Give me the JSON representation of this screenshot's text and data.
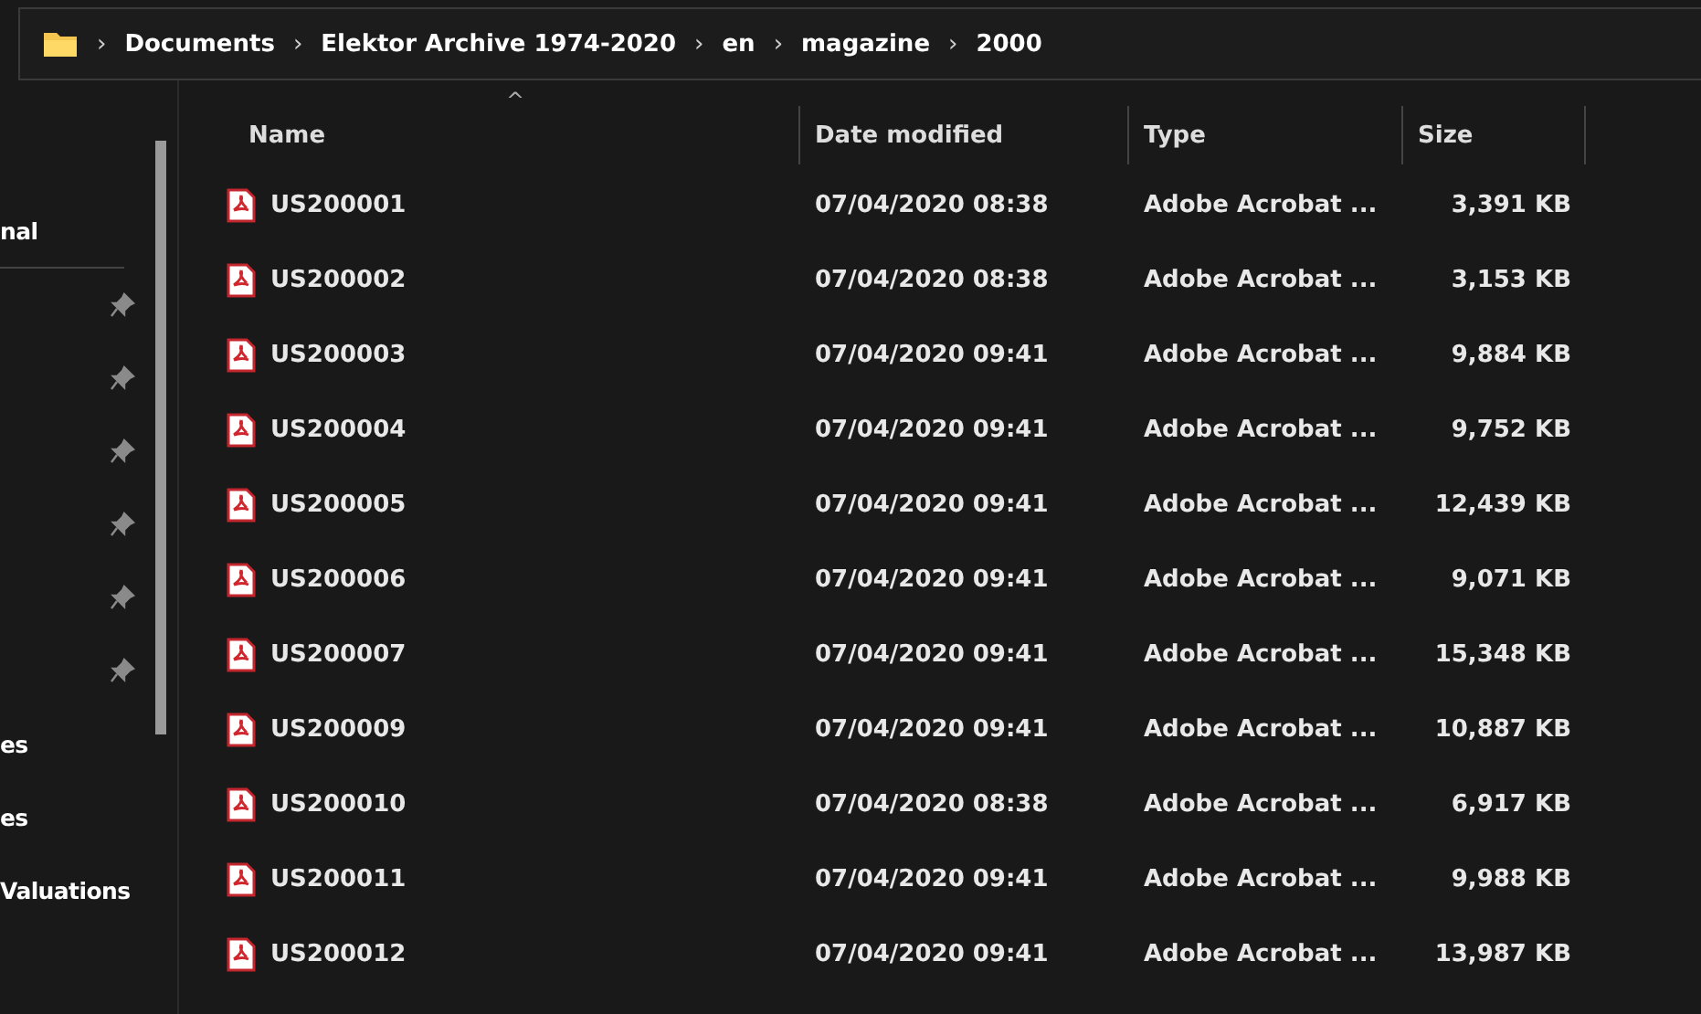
{
  "breadcrumb": {
    "segments": [
      "Documents",
      "Elektor Archive 1974-2020",
      "en",
      "magazine",
      "2000"
    ],
    "separator": "›"
  },
  "sidebar": {
    "items": [
      {
        "label": "nal",
        "pinned": false
      },
      {
        "pinned": true
      },
      {
        "pinned": true
      },
      {
        "pinned": true
      },
      {
        "pinned": true
      },
      {
        "pinned": true
      },
      {
        "pinned": true
      },
      {
        "label": "es",
        "pinned": false
      },
      {
        "label": "es",
        "pinned": false
      },
      {
        "label": "Valuations",
        "pinned": false
      }
    ]
  },
  "table": {
    "sort_indicator": "^",
    "columns": [
      "Name",
      "Date modified",
      "Type",
      "Size"
    ],
    "rows": [
      {
        "name": "US200001",
        "date": "07/04/2020 08:38",
        "type": "Adobe Acrobat ...",
        "size": "3,391 KB"
      },
      {
        "name": "US200002",
        "date": "07/04/2020 08:38",
        "type": "Adobe Acrobat ...",
        "size": "3,153 KB"
      },
      {
        "name": "US200003",
        "date": "07/04/2020 09:41",
        "type": "Adobe Acrobat ...",
        "size": "9,884 KB"
      },
      {
        "name": "US200004",
        "date": "07/04/2020 09:41",
        "type": "Adobe Acrobat ...",
        "size": "9,752 KB"
      },
      {
        "name": "US200005",
        "date": "07/04/2020 09:41",
        "type": "Adobe Acrobat ...",
        "size": "12,439 KB"
      },
      {
        "name": "US200006",
        "date": "07/04/2020 09:41",
        "type": "Adobe Acrobat ...",
        "size": "9,071 KB"
      },
      {
        "name": "US200007",
        "date": "07/04/2020 09:41",
        "type": "Adobe Acrobat ...",
        "size": "15,348 KB"
      },
      {
        "name": "US200009",
        "date": "07/04/2020 09:41",
        "type": "Adobe Acrobat ...",
        "size": "10,887 KB"
      },
      {
        "name": "US200010",
        "date": "07/04/2020 08:38",
        "type": "Adobe Acrobat ...",
        "size": "6,917 KB"
      },
      {
        "name": "US200011",
        "date": "07/04/2020 09:41",
        "type": "Adobe Acrobat ...",
        "size": "9,988 KB"
      },
      {
        "name": "US200012",
        "date": "07/04/2020 09:41",
        "type": "Adobe Acrobat ...",
        "size": "13,987 KB"
      }
    ]
  }
}
